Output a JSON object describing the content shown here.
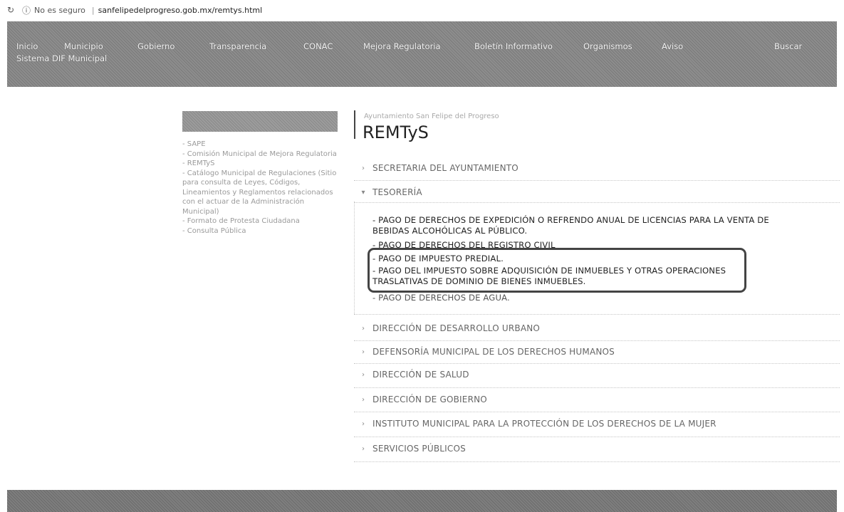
{
  "browser": {
    "refresh_icon": "refresh-icon",
    "security_text": "No es seguro",
    "url": "sanfelipedelprogreso.gob.mx/remtys.html"
  },
  "nav": {
    "inicio": "Inicio",
    "municipio": "Municipio",
    "gobierno": "Gobierno",
    "transparencia": "Transparencia",
    "conac": "CONAC",
    "mejora": "Mejora Regulatoria",
    "boletin": "Boletín Informativo",
    "organismos": "Organismos",
    "aviso": "Aviso",
    "buscar": "Buscar",
    "dif": "Sistema DIF Municipal"
  },
  "sidebar": {
    "items": [
      "- SAPE",
      "- Comisión Municipal de Mejora Regulatoria",
      "- REMTyS",
      "- Catálogo Municipal de Regulaciones (Sitio para consulta de Leyes, Códigos, Lineamientos y Reglamentos relacionados con el actuar de la Administración Municipal)",
      "- Formato de Protesta Ciudadana",
      "- Consulta Pública"
    ]
  },
  "page": {
    "breadcrumb": "Ayuntamiento San Felipe del Progreso",
    "title": "REMTyS"
  },
  "sections": {
    "secretaria": "SECRETARIA DEL AYUNTAMIENTO",
    "tesoreria": "TESORERÍA",
    "desarrollo": "DIRECCIÓN DE DESARROLLO URBANO",
    "defensoria": "DEFENSORÍA MUNICIPAL DE LOS DERECHOS HUMANOS",
    "salud": "DIRECCIÓN DE SALUD",
    "gobierno": "DIRECCIÓN DE GOBIERNO",
    "instituto": "INSTITUTO MUNICIPAL PARA LA PROTECCIÓN DE LOS DERECHOS DE LA MUJER",
    "servicios": "SERVICIOS PÚBLICOS"
  },
  "tesoreria_items": {
    "item1_line1": "- PAGO DE DERECHOS DE EXPEDICIÓN O REFRENDO ANUAL DE LICENCIAS PARA LA VENTA DE",
    "item1_line2": "BEBIDAS ALCOHÓLICAS AL PÚBLICO.",
    "item2": "- PAGO DE DERECHOS DEL REGISTRO CIVIL",
    "item3": "- PAGO DE IMPUESTO PREDIAL.",
    "item4_line1": "- PAGO DEL IMPUESTO SOBRE ADQUISICIÓN DE INMUEBLES Y OTRAS OPERACIONES",
    "item4_line2": "TRASLATIVAS DE DOMINIO DE BIENES INMUEBLES.",
    "item5": "- PAGO DE DERECHOS DE AGUA."
  }
}
